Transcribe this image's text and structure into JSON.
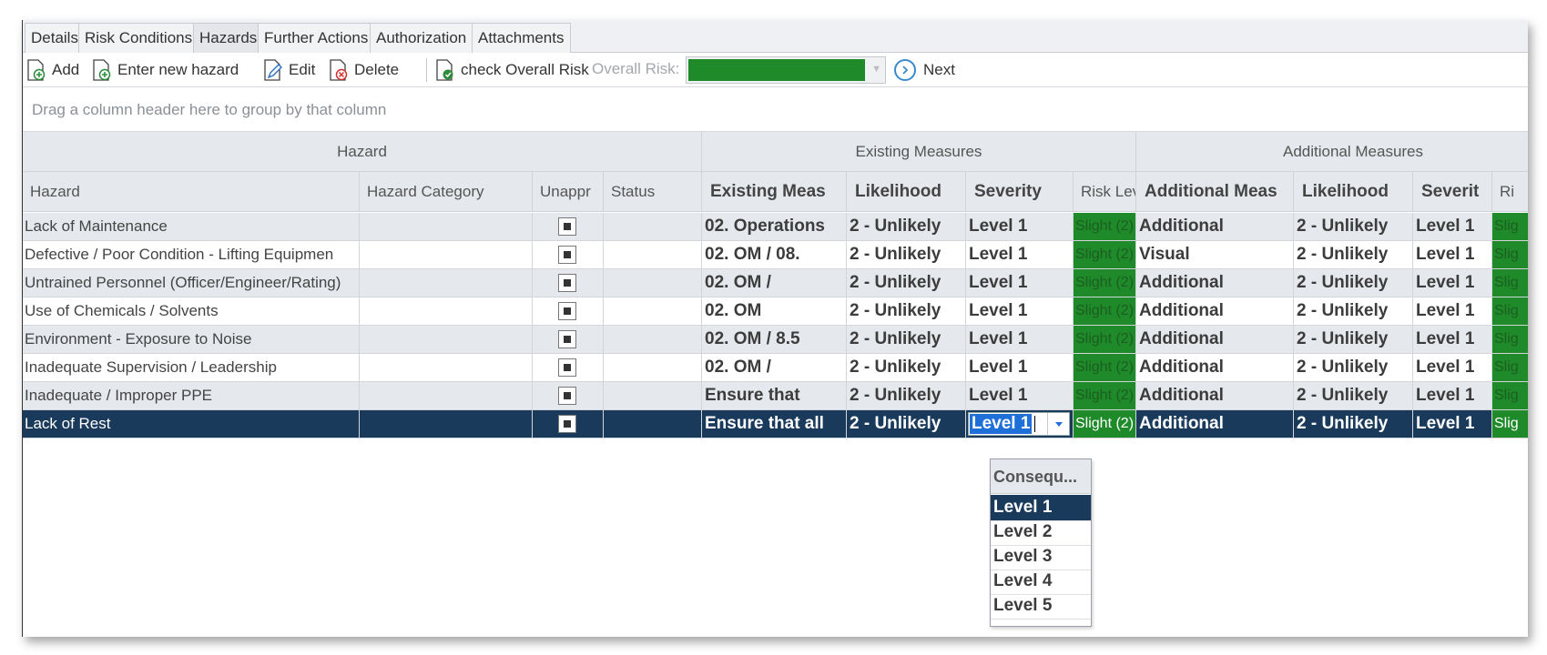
{
  "tabs": [
    "Details",
    "Risk Conditions",
    "Hazards",
    "Further Actions",
    "Authorization",
    "Attachments"
  ],
  "active_tab": "Hazards",
  "toolbar": {
    "add": "Add",
    "enter_new_hazard": "Enter new hazard",
    "edit": "Edit",
    "delete": "Delete",
    "check_overall_risk": "check Overall Risk",
    "overall_risk_label": "Overall Risk:",
    "overall_risk_color": "#1f8a2a",
    "next": "Next"
  },
  "group_panel_hint": "Drag a column header here to group by that column",
  "bands": {
    "hazard": "Hazard",
    "existing": "Existing Measures",
    "additional": "Additional Measures"
  },
  "columns": {
    "hazard": "Hazard",
    "category": "Hazard Category",
    "unappr": "Unappr",
    "status": "Status",
    "existing_meas": "Existing Meas",
    "likelihood": "Likelihood",
    "severity": "Severity",
    "risk_level": "Risk Leve",
    "additional_meas": "Additional Meas",
    "likelihood2": "Likelihood",
    "severity2": "Severit",
    "risk2": "Ri"
  },
  "rows": [
    {
      "hazard": "Lack of Maintenance",
      "existing": "02. Operations",
      "likelihood": "2 - Unlikely",
      "severity": "Level 1",
      "risk": "Slight (2)",
      "additional": "Additional",
      "likelihood2": "2 - Unlikely",
      "severity2": "Level 1",
      "risk2": "Slig"
    },
    {
      "hazard": "Defective / Poor Condition - Lifting Equipmen",
      "existing": "02. OM / 08.",
      "likelihood": "2 - Unlikely",
      "severity": "Level 1",
      "risk": "Slight (2)",
      "additional": "Visual",
      "likelihood2": "2 - Unlikely",
      "severity2": "Level 1",
      "risk2": "Slig"
    },
    {
      "hazard": "Untrained Personnel (Officer/Engineer/Rating)",
      "existing": "02. OM /",
      "likelihood": "2 - Unlikely",
      "severity": "Level 1",
      "risk": "Slight (2)",
      "additional": "Additional",
      "likelihood2": "2 - Unlikely",
      "severity2": "Level 1",
      "risk2": "Slig"
    },
    {
      "hazard": "Use of Chemicals / Solvents",
      "existing": "02. OM",
      "likelihood": "2 - Unlikely",
      "severity": "Level 1",
      "risk": "Slight (2)",
      "additional": "Additional",
      "likelihood2": "2 - Unlikely",
      "severity2": "Level 1",
      "risk2": "Slig"
    },
    {
      "hazard": "Environment - Exposure to Noise",
      "existing": "02. OM / 8.5",
      "likelihood": "2 - Unlikely",
      "severity": "Level 1",
      "risk": "Slight (2)",
      "additional": "Additional",
      "likelihood2": "2 - Unlikely",
      "severity2": "Level 1",
      "risk2": "Slig"
    },
    {
      "hazard": "Inadequate Supervision / Leadership",
      "existing": "02. OM /",
      "likelihood": "2 - Unlikely",
      "severity": "Level 1",
      "risk": "Slight (2)",
      "additional": "Additional",
      "likelihood2": "2 - Unlikely",
      "severity2": "Level 1",
      "risk2": "Slig"
    },
    {
      "hazard": "Inadequate / Improper PPE",
      "existing": "Ensure that",
      "likelihood": "2 - Unlikely",
      "severity": "Level 1",
      "risk": "Slight (2)",
      "additional": "Additional",
      "likelihood2": "2 - Unlikely",
      "severity2": "Level 1",
      "risk2": "Slig"
    },
    {
      "hazard": "Lack of Rest",
      "existing": "Ensure that all",
      "likelihood": "2 - Unlikely",
      "severity": "Level 1",
      "risk": "Slight (2)",
      "additional": "Additional",
      "likelihood2": "2 - Unlikely",
      "severity2": "Level 1",
      "risk2": "Slig"
    }
  ],
  "selected_row": 7,
  "editor_value": "Level 1",
  "dropdown": {
    "header": "Consequ...",
    "options": [
      "Level 1",
      "Level 2",
      "Level 3",
      "Level 4",
      "Level 5"
    ],
    "selected": "Level 1"
  },
  "colors": {
    "risk_green": "#1f8a2a",
    "selection": "#1a3a5c"
  }
}
